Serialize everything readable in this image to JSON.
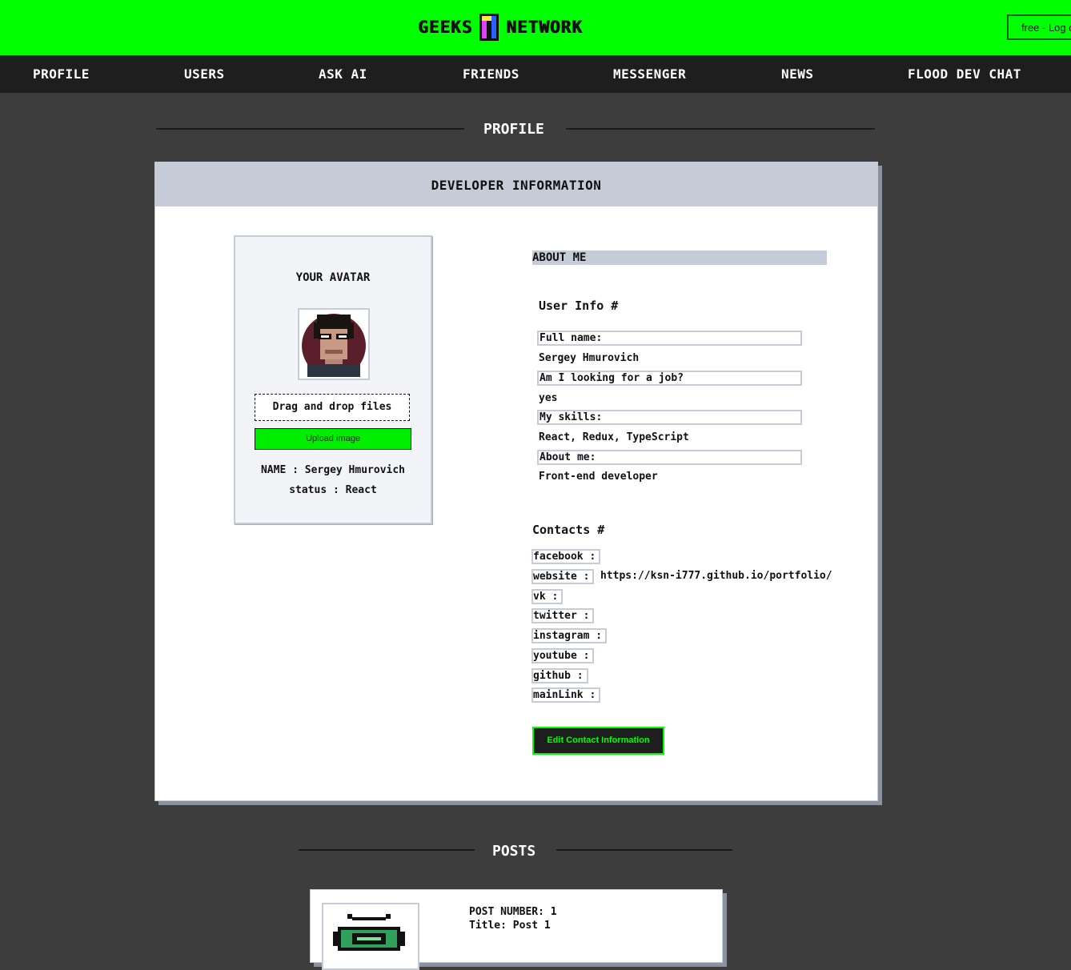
{
  "header": {
    "logo_left": "GEEKS",
    "logo_right": "NETWORK",
    "login_label": "free - Log out"
  },
  "nav": [
    "PROFILE",
    "USERS",
    "ASK AI",
    "FRIENDS",
    "MESSENGER",
    "NEWS",
    "FLOOD DEV CHAT"
  ],
  "page": {
    "title": "PROFILE"
  },
  "card": {
    "title": "DEVELOPER INFORMATION",
    "avatar": {
      "title": "YOUR AVATAR",
      "drop_label": "Drag and drop files",
      "upload_label": "Upload image",
      "name_line": "NAME : Sergey Hmurovich",
      "status_line": "status : React"
    },
    "about": {
      "title": "ABOUT ME",
      "user_info_title": "User Info #",
      "fields": [
        {
          "label": "Full name:",
          "value": "Sergey Hmurovich"
        },
        {
          "label": "Am I looking for a job?",
          "value": "yes"
        },
        {
          "label": "My skills:",
          "value": "React, Redux, TypeScript"
        },
        {
          "label": "About me:",
          "value": "Front-end developer"
        }
      ],
      "contacts_title": "Contacts #",
      "contacts": [
        {
          "label": "facebook :",
          "value": ""
        },
        {
          "label": "website :",
          "value": "https://ksn-i777.github.io/portfolio/"
        },
        {
          "label": "vk :",
          "value": ""
        },
        {
          "label": "twitter :",
          "value": ""
        },
        {
          "label": "instagram :",
          "value": ""
        },
        {
          "label": "youtube :",
          "value": ""
        },
        {
          "label": "github :",
          "value": ""
        },
        {
          "label": "mainLink :",
          "value": ""
        }
      ],
      "edit_label": "Edit Contact Information"
    }
  },
  "posts": {
    "title": "POSTS",
    "items": [
      {
        "number_line": "POST NUMBER: 1",
        "title_line": "Title: Post 1"
      }
    ]
  },
  "colors": {
    "accent": "#00ff00",
    "nav_bg": "#1e1e1e",
    "page_bg": "#3d3d3d",
    "panel_head": "#c5ccd8"
  }
}
